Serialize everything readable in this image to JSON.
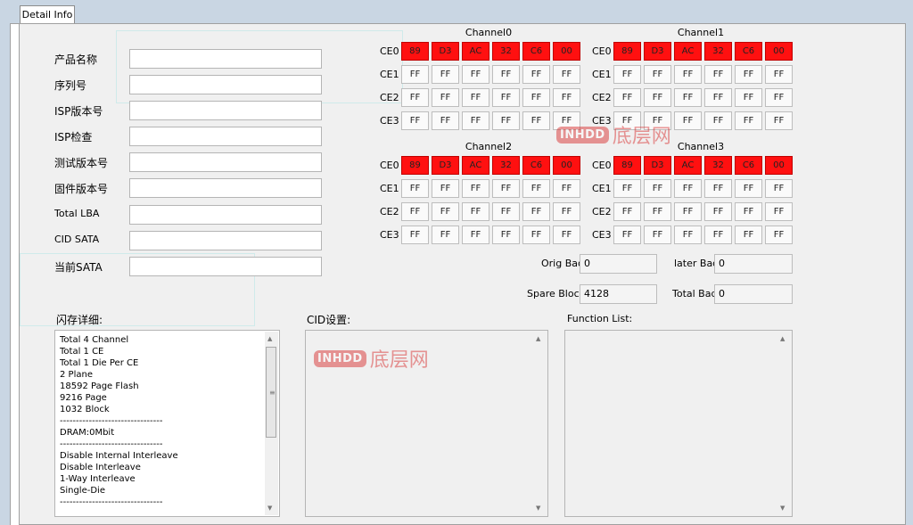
{
  "tab": {
    "label": "Detail Info"
  },
  "fields": [
    {
      "label": "产品名称",
      "value": ""
    },
    {
      "label": "序列号",
      "value": ""
    },
    {
      "label": "ISP版本号",
      "value": ""
    },
    {
      "label": "ISP检查",
      "value": ""
    },
    {
      "label": "测试版本号",
      "value": ""
    },
    {
      "label": "固件版本号",
      "value": ""
    },
    {
      "label": "Total LBA",
      "value": ""
    },
    {
      "label": "CID SATA",
      "value": ""
    },
    {
      "label": "当前SATA",
      "value": ""
    }
  ],
  "ce_labels": [
    "CE0",
    "CE1",
    "CE2",
    "CE3"
  ],
  "channels": [
    {
      "title": "Channel0",
      "rows": [
        [
          "89",
          "D3",
          "AC",
          "32",
          "C6",
          "00"
        ],
        [
          "FF",
          "FF",
          "FF",
          "FF",
          "FF",
          "FF"
        ],
        [
          "FF",
          "FF",
          "FF",
          "FF",
          "FF",
          "FF"
        ],
        [
          "FF",
          "FF",
          "FF",
          "FF",
          "FF",
          "FF"
        ]
      ]
    },
    {
      "title": "Channel1",
      "rows": [
        [
          "89",
          "D3",
          "AC",
          "32",
          "C6",
          "00"
        ],
        [
          "FF",
          "FF",
          "FF",
          "FF",
          "FF",
          "FF"
        ],
        [
          "FF",
          "FF",
          "FF",
          "FF",
          "FF",
          "FF"
        ],
        [
          "FF",
          "FF",
          "FF",
          "FF",
          "FF",
          "FF"
        ]
      ]
    },
    {
      "title": "Channel2",
      "rows": [
        [
          "89",
          "D3",
          "AC",
          "32",
          "C6",
          "00"
        ],
        [
          "FF",
          "FF",
          "FF",
          "FF",
          "FF",
          "FF"
        ],
        [
          "FF",
          "FF",
          "FF",
          "FF",
          "FF",
          "FF"
        ],
        [
          "FF",
          "FF",
          "FF",
          "FF",
          "FF",
          "FF"
        ]
      ]
    },
    {
      "title": "Channel3",
      "rows": [
        [
          "89",
          "D3",
          "AC",
          "32",
          "C6",
          "00"
        ],
        [
          "FF",
          "FF",
          "FF",
          "FF",
          "FF",
          "FF"
        ],
        [
          "FF",
          "FF",
          "FF",
          "FF",
          "FF",
          "FF"
        ],
        [
          "FF",
          "FF",
          "FF",
          "FF",
          "FF",
          "FF"
        ]
      ]
    }
  ],
  "colors": {
    "highlight": "#ff1010",
    "watermark": "#d61f1f"
  },
  "stats": {
    "orig_bad": {
      "label": "Orig Bad",
      "value": "0"
    },
    "later_bad": {
      "label": "later Bad",
      "value": "0"
    },
    "spare_block": {
      "label": "Spare Block",
      "value": "4128"
    },
    "total_bad": {
      "label": "Total Bad",
      "value": "0"
    }
  },
  "sections": {
    "flash": {
      "title": "闪存详细:"
    },
    "cid": {
      "title": "CID设置:"
    },
    "func": {
      "title": "Function List:"
    }
  },
  "flash_lines": [
    "Total 4 Channel",
    "Total 1 CE",
    "Total 1 Die Per CE",
    "2 Plane",
    "18592 Page Flash",
    "9216 Page",
    "1032 Block",
    "--------------------------------",
    "DRAM:0Mbit",
    "--------------------------------",
    "Disable Internal Interleave",
    "Disable Interleave",
    "1-Way Interleave",
    "Single-Die",
    "--------------------------------"
  ],
  "watermark": {
    "badge": "INHDD",
    "text": "底层网"
  }
}
